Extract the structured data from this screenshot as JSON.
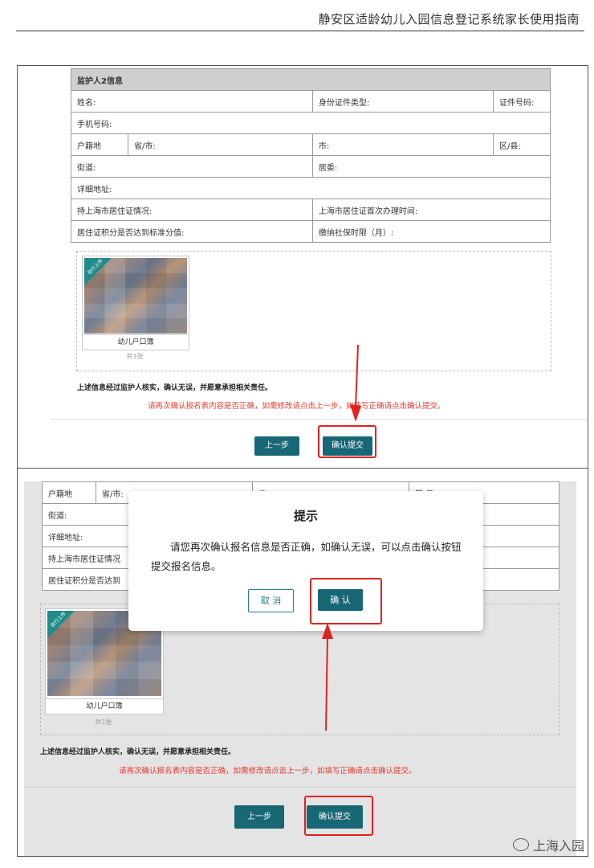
{
  "doc": {
    "header": "静安区适龄幼儿入园信息登记系统家长使用指南"
  },
  "panel1": {
    "section_title": "监护人2信息",
    "rows": [
      [
        "姓名:",
        "身份证件类型:",
        "证件号码:"
      ],
      [
        "手机号码:"
      ],
      [
        "户籍地",
        "省/市:",
        "市:",
        "区/县:"
      ],
      [
        "街道:",
        "居委:"
      ],
      [
        "详细地址:"
      ],
      [
        "持上海市居住证情况:",
        "上海市居住证首次办理时间:"
      ],
      [
        "居住证积分是否达到标准分值:",
        "缴纳社保时限（月）:"
      ]
    ],
    "upload_tag": "自行上传",
    "photo_caption": "幼儿户口簿",
    "photo_count": "共1张",
    "confirm_text": "上述信息经过监护人核实，确认无误，并愿意承担相关责任。",
    "warning_text": "请再次确认报名表内容是否正确，如需修改请点击上一步，如填写正确请点击确认提交。",
    "prev_button": "上一步",
    "submit_button": "确认提交"
  },
  "panel2": {
    "rows": [
      [
        "户籍地",
        "省/市:",
        "市:",
        "区/县:"
      ],
      [
        "街道:"
      ],
      [
        "详细地址:"
      ],
      [
        "持上海市居住证情况"
      ],
      [
        "居住证积分是否达到"
      ]
    ],
    "upload_tag": "自行上传",
    "photo_caption": "幼儿户口簿",
    "photo_count": "共1张",
    "confirm_text": "上述信息经过监护人核实，确认无误，并愿意承担相关责任。",
    "warning_text": "请再次确认报名表内容是否正确，如需修改请点击上一步，如填写正确请点击确认提交。",
    "prev_button": "上一步",
    "submit_button": "确认提交",
    "dialog": {
      "title": "提示",
      "message": "请您再次确认报名信息是否正确，如确认无误，可以点击确认按钮提交报名信息。",
      "cancel": "取 消",
      "ok": "确 认"
    }
  },
  "watermark": "上海入园",
  "colors": {
    "primary": "#176774",
    "warning": "#e53a2f",
    "highlight": "#e3211f"
  }
}
